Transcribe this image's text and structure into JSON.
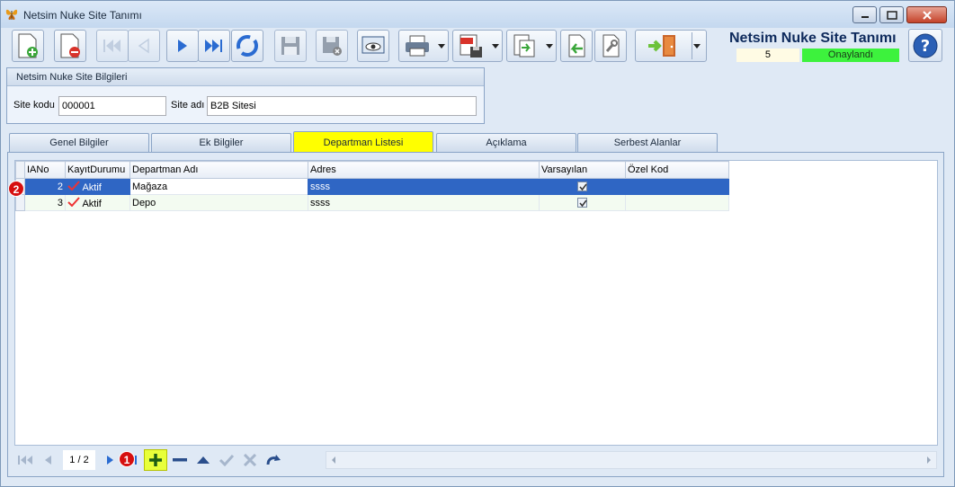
{
  "window": {
    "title": "Netsim Nuke Site Tanımı",
    "icon": "butterfly-icon"
  },
  "toolbar": {
    "icons": [
      "new-document-icon",
      "delete-document-icon",
      "first-record-icon",
      "previous-record-icon",
      "next-record-icon",
      "last-record-icon",
      "refresh-icon",
      "save-icon",
      "cancel-save-icon",
      "preview-icon",
      "print-icon",
      "pdf-export-icon",
      "export-icon",
      "import-icon",
      "properties-icon",
      "exit-icon"
    ]
  },
  "header": {
    "title": "Netsim Nuke Site Tanımı",
    "record_number": "5",
    "status": "Onaylandı",
    "status_color": "#3df23d"
  },
  "site_info": {
    "group_title": "Netsim Nuke Site Bilgileri",
    "code_label": "Site kodu",
    "code_value": "000001",
    "name_label": "Site adı",
    "name_value": "B2B Sitesi"
  },
  "tabs": [
    {
      "label": "Genel Bilgiler"
    },
    {
      "label": "Ek Bilgiler"
    },
    {
      "label": "Departman Listesi"
    },
    {
      "label": "Açıklama"
    },
    {
      "label": "Serbest Alanlar"
    }
  ],
  "grid": {
    "columns": [
      "IANo",
      "KayıtDurumu",
      "Departman Adı",
      "Adres",
      "Varsayılan",
      "Özel Kod"
    ],
    "rows": [
      {
        "no": "2",
        "status": "Aktif",
        "name": "Mağaza",
        "address": "ssss",
        "default": true,
        "code": ""
      },
      {
        "no": "3",
        "status": "Aktif",
        "name": "Depo",
        "address": "ssss",
        "default": true,
        "code": ""
      }
    ]
  },
  "navigator": {
    "page_info": "1 / 2"
  },
  "annotations": {
    "badge_1": "1",
    "badge_2": "2"
  },
  "colors": {
    "active_tab": "#ffff00",
    "selected_row": "#2f66c4",
    "badge": "#d60f0f"
  }
}
